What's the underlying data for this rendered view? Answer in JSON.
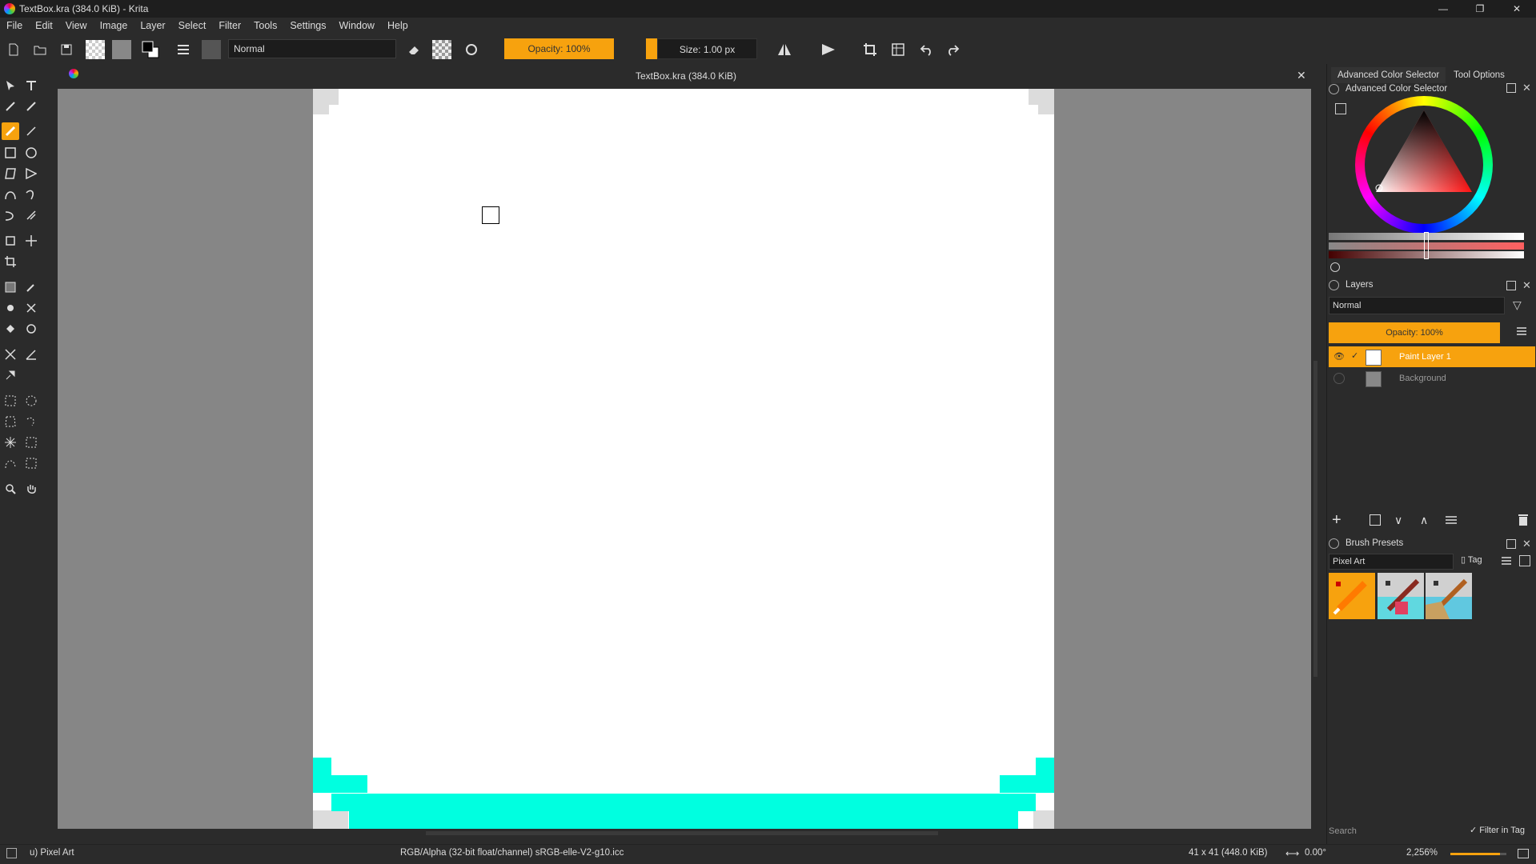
{
  "window": {
    "title": "TextBox.kra (384.0 KiB)  - Krita",
    "minimize": "—",
    "maximize": "❐",
    "close": "✕"
  },
  "menu": [
    "File",
    "Edit",
    "View",
    "Image",
    "Layer",
    "Select",
    "Filter",
    "Tools",
    "Settings",
    "Window",
    "Help"
  ],
  "toolbar": {
    "blend_mode": "Normal",
    "opacity": "Opacity: 100%",
    "size": "Size: 1.00 px"
  },
  "document": {
    "tab_title": "TextBox.kra (384.0 KiB)",
    "close": "✕"
  },
  "dock": {
    "tabs": [
      "Advanced Color Selector",
      "Tool Options"
    ],
    "color_selector_title": "Advanced Color Selector",
    "layers_title": "Layers",
    "layers_blend_mode": "Normal",
    "layers_opacity": "Opacity:  100%",
    "layers": [
      {
        "name": "Paint Layer 1",
        "selected": true
      },
      {
        "name": "Background",
        "selected": false
      }
    ],
    "brush_presets_title": "Brush Presets",
    "brush_tag": "Pixel Art",
    "tag_button": "Tag",
    "search_placeholder": "Search",
    "filter_in_tag": "Filter in Tag"
  },
  "status": {
    "brush": "u) Pixel Art",
    "color_space": "RGB/Alpha (32-bit float/channel)  sRGB-elle-V2-g10.icc",
    "image_size": "41 x 41 (448.0 KiB)",
    "rotation": "0.00°",
    "zoom": "2,256%"
  },
  "colors": {
    "accent": "#f7a20e",
    "canvas_bg": "#868686",
    "textbox_fill": "#00ffe0",
    "ui_bg": "#2b2b2b"
  }
}
